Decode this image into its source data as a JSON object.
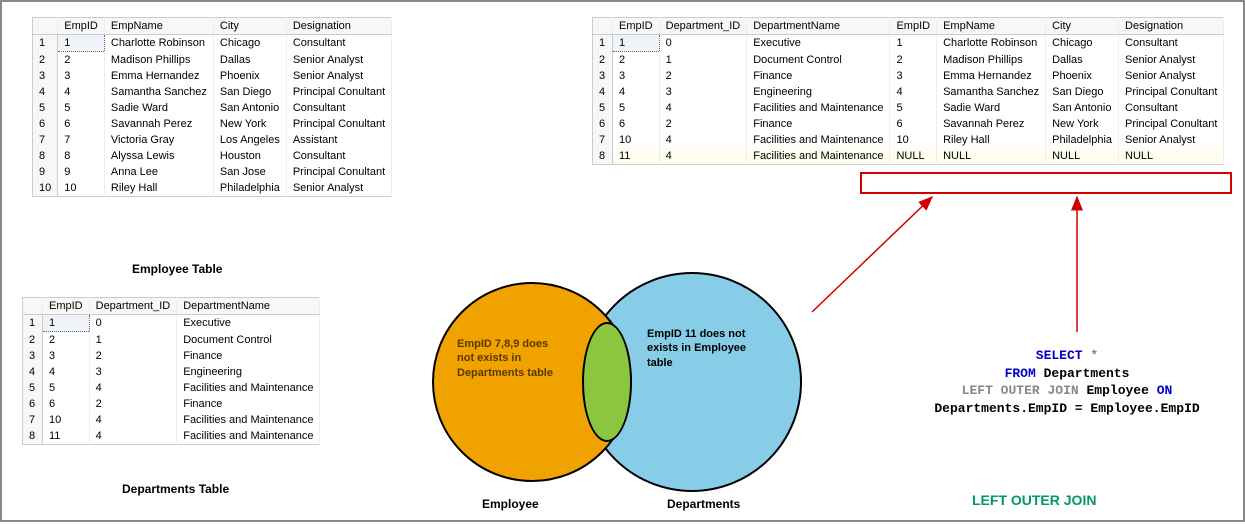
{
  "employee_table": {
    "caption": "Employee Table",
    "headers": [
      "",
      "EmpID",
      "EmpName",
      "City",
      "Designation"
    ],
    "rows": [
      [
        "1",
        "1",
        "Charlotte Robinson",
        "Chicago",
        "Consultant"
      ],
      [
        "2",
        "2",
        "Madison Phillips",
        "Dallas",
        "Senior Analyst"
      ],
      [
        "3",
        "3",
        "Emma Hernandez",
        "Phoenix",
        "Senior Analyst"
      ],
      [
        "4",
        "4",
        "Samantha Sanchez",
        "San Diego",
        "Principal Conultant"
      ],
      [
        "5",
        "5",
        "Sadie Ward",
        "San Antonio",
        "Consultant"
      ],
      [
        "6",
        "6",
        "Savannah Perez",
        "New York",
        "Principal Conultant"
      ],
      [
        "7",
        "7",
        "Victoria Gray",
        "Los Angeles",
        "Assistant"
      ],
      [
        "8",
        "8",
        "Alyssa Lewis",
        "Houston",
        "Consultant"
      ],
      [
        "9",
        "9",
        "Anna Lee",
        "San Jose",
        "Principal Conultant"
      ],
      [
        "10",
        "10",
        "Riley Hall",
        "Philadelphia",
        "Senior Analyst"
      ]
    ]
  },
  "departments_table": {
    "caption": "Departments Table",
    "headers": [
      "",
      "EmpID",
      "Department_ID",
      "DepartmentName"
    ],
    "rows": [
      [
        "1",
        "1",
        "0",
        "Executive"
      ],
      [
        "2",
        "2",
        "1",
        "Document Control"
      ],
      [
        "3",
        "3",
        "2",
        "Finance"
      ],
      [
        "4",
        "4",
        "3",
        "Engineering"
      ],
      [
        "5",
        "5",
        "4",
        "Facilities and Maintenance"
      ],
      [
        "6",
        "6",
        "2",
        "Finance"
      ],
      [
        "7",
        "10",
        "4",
        "Facilities and Maintenance"
      ],
      [
        "8",
        "11",
        "4",
        "Facilities and Maintenance"
      ]
    ]
  },
  "result_table": {
    "headers": [
      "",
      "EmpID",
      "Department_ID",
      "DepartmentName",
      "EmpID",
      "EmpName",
      "City",
      "Designation"
    ],
    "rows": [
      [
        "1",
        "1",
        "0",
        "Executive",
        "1",
        "Charlotte Robinson",
        "Chicago",
        "Consultant"
      ],
      [
        "2",
        "2",
        "1",
        "Document Control",
        "2",
        "Madison Phillips",
        "Dallas",
        "Senior Analyst"
      ],
      [
        "3",
        "3",
        "2",
        "Finance",
        "3",
        "Emma Hernandez",
        "Phoenix",
        "Senior Analyst"
      ],
      [
        "4",
        "4",
        "3",
        "Engineering",
        "4",
        "Samantha Sanchez",
        "San Diego",
        "Principal Conultant"
      ],
      [
        "5",
        "5",
        "4",
        "Facilities and Maintenance",
        "5",
        "Sadie Ward",
        "San Antonio",
        "Consultant"
      ],
      [
        "6",
        "6",
        "2",
        "Finance",
        "6",
        "Savannah Perez",
        "New York",
        "Principal Conultant"
      ],
      [
        "7",
        "10",
        "4",
        "Facilities and Maintenance",
        "10",
        "Riley Hall",
        "Philadelphia",
        "Senior Analyst"
      ],
      [
        "8",
        "11",
        "4",
        "Facilities and Maintenance",
        "NULL",
        "NULL",
        "NULL",
        "NULL"
      ]
    ]
  },
  "venn": {
    "left_label": "Employee",
    "right_label": "Departments",
    "left_text": "EmpID 7,8,9 does not exists in Departments table",
    "right_text": "EmpID 11 does not exists in Employee table"
  },
  "sql": {
    "line1a": "SELECT",
    "line1b": " *",
    "line2a": "FROM",
    "line2b": " Departments",
    "line3a": "LEFT OUTER JOIN",
    "line3b": " Employee ",
    "line3c": "ON",
    "line4": "Departments.EmpID = Employee.EmpID"
  },
  "join_label": "LEFT OUTER JOIN"
}
